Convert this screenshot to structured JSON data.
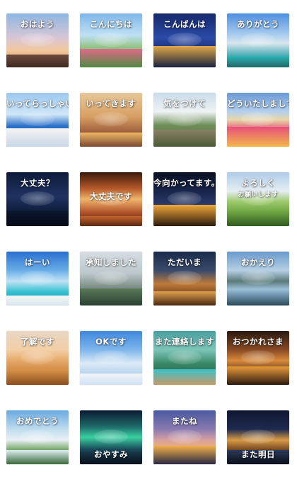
{
  "stickers": [
    {
      "id": "ohayou",
      "text": "おはよう",
      "pos": "top",
      "bg": "linear-gradient(180deg,#8fb6e2 0%,#d8c6d6 45%,#f3c79a 70%,#a86b4a 100%)",
      "ground": "linear-gradient(180deg,#6e4a3a,#3f2a22)",
      "gh": 18
    },
    {
      "id": "konnichiwa",
      "text": "こんにちは",
      "pos": "top",
      "bg": "linear-gradient(180deg,#7fb7e8 0%,#bfe0f5 40%,#8fc27a 65%,#3f7a3a 100%)",
      "ground": "linear-gradient(180deg,#e06a8a,#4f8a3f)",
      "gh": 26
    },
    {
      "id": "konbanwa",
      "text": "こんばんは",
      "pos": "top",
      "bg": "linear-gradient(180deg,#15286b 0%,#2b4aa8 45%,#1b2d6e 70%,#0d1634 100%)",
      "ground": "linear-gradient(180deg,#e0a84a,#1a2240)",
      "gh": 30
    },
    {
      "id": "arigatou",
      "text": "ありがとう",
      "pos": "top",
      "bg": "linear-gradient(180deg,#4f8fe0 0%,#a9cdef 40%,#d9e6ee 55%,#3fa7b0 80%,#2a6e6a 100%)",
      "ground": "linear-gradient(180deg,#2fb3b8,#1f6a66)",
      "gh": 16
    },
    {
      "id": "itterasshai",
      "text": "いってらっしゃい",
      "pos": "top",
      "bg": "linear-gradient(180deg,#9cc8f0 0%,#cfe6f7 40%,#2a6fc9 62%,#1d4fa0 100%)",
      "ground": "linear-gradient(180deg,#f4f4f4,#c9d6e6)",
      "gh": 26
    },
    {
      "id": "ittekimasu",
      "text": "いってきます",
      "pos": "top",
      "bg": "linear-gradient(180deg,#e7c89a 0%,#d79e62 45%,#9a5a3a 75%,#5a3524 100%)",
      "ground": "linear-gradient(180deg,#f0b765,#7a4a30)",
      "gh": 20
    },
    {
      "id": "kiotsukete",
      "text": "気をつけて",
      "pos": "top",
      "bg": "linear-gradient(180deg,#c9dbe9 0%,#eef2f4 35%,#6f8f5a 60%,#4c6a3a 100%)",
      "ground": "linear-gradient(180deg,#8a8066,#4a5a34)",
      "gh": 24
    },
    {
      "id": "douitashimashite",
      "text": "どういたしまして",
      "pos": "top",
      "bg": "linear-gradient(180deg,#6a9ad8 0%,#b5d0ee 35%,#e8d6a8 50%,#e25a7a 68%,#f0c24a 84%,#d23a5a 100%)",
      "ground": "linear-gradient(180deg,#e8507a,#f2b84a)",
      "gh": 28
    },
    {
      "id": "daijoubu-q",
      "text": "大丈夫？",
      "pos": "top",
      "bg": "linear-gradient(180deg,#0e1a3a 0%,#1f3262 45%,#10203f 70%,#071022 100%)",
      "ground": "linear-gradient(180deg,#0c1830,#050a16)",
      "gh": 22
    },
    {
      "id": "daijoubudesu",
      "text": "大丈夫です",
      "pos": "mid",
      "bg": "linear-gradient(180deg,#3a1a0c 0%,#b5582a 30%,#f0b46a 50%,#b0522a 75%,#3a180a 100%)",
      "ground": "linear-gradient(180deg,#c4622c,#5a2a12)",
      "gh": 14
    },
    {
      "id": "imamukattemasu",
      "text": "今向かってます。",
      "pos": "top",
      "bg": "linear-gradient(180deg,#0a1124 0%,#1b2850 40%,#2a3a6a 60%,#0d1530 100%)",
      "ground": "linear-gradient(180deg,#f2a83a,#2a1a10)",
      "gh": 30
    },
    {
      "id": "yoroshiku",
      "text": "よろしく",
      "sub": "お願いします",
      "pos": "top",
      "bg": "linear-gradient(180deg,#aecbe8 0%,#e6eef2 35%,#9cc86a 55%,#5e9a3a 80%,#3a6a24 100%)",
      "ground": "linear-gradient(180deg,#7ab44a,#2f5a20)",
      "gh": 24
    },
    {
      "id": "haai",
      "text": "はーい",
      "pos": "top",
      "bg": "linear-gradient(180deg,#2a6fd0 0%,#6aaee8 35%,#bfe2f4 55%,#34c0d0 75%,#1a8fa8 100%)",
      "ground": "linear-gradient(180deg,#f4f6f8,#d6e6ee)",
      "gh": 14
    },
    {
      "id": "shouchishimashita",
      "text": "承知しました",
      "pos": "top",
      "bg": "linear-gradient(180deg,#d6dde2 0%,#bcc8cc 40%,#7f918a 65%,#3f5a4a 100%)",
      "ground": "linear-gradient(180deg,#5a7a5a,#2a3f30)",
      "gh": 24
    },
    {
      "id": "tadaima",
      "text": "ただいま",
      "pos": "top",
      "bg": "linear-gradient(180deg,#1a2a4a 0%,#3a4a6a 35%,#c07a3a 60%,#6a3a1a 85%,#2a1408 100%)",
      "ground": "linear-gradient(180deg,#e0a050,#4a2810)",
      "gh": 20
    },
    {
      "id": "okaeri",
      "text": "おかえり",
      "pos": "top",
      "bg": "linear-gradient(180deg,#6a9acc 0%,#b6cfe4 35%,#5a7a7a 55%,#9cc0d8 70%,#2a4a5a 100%)",
      "ground": "linear-gradient(180deg,#8ab0cc,#2a4a5a)",
      "gh": 20
    },
    {
      "id": "ryoukaidesu",
      "text": "了解です",
      "pos": "top",
      "bg": "linear-gradient(180deg,#e8d6c4 0%,#f2cfa6 35%,#e6a868 55%,#c9803a 80%,#9a5a24 100%)",
      "ground": "linear-gradient(180deg,#d9944a,#8a4e1e)",
      "gh": 22
    },
    {
      "id": "okdesu",
      "text": "OKです",
      "pos": "top",
      "bg": "linear-gradient(180deg,#3f88dc 0%,#7fb6ec 35%,#dceaf6 60%,#b8d4ee 80%,#8ab8e4 100%)",
      "ground": "linear-gradient(180deg,#f2f6fa,#cfe0f2)",
      "gh": 16
    },
    {
      "id": "matarenraku",
      "text": "また連絡します",
      "pos": "top",
      "bg": "linear-gradient(180deg,#4aa0a0 0%,#7cc4b8 35%,#3a8a6a 60%,#2a6a4a 80%,#1a4a34 100%)",
      "ground": "linear-gradient(180deg,#3ec0c8,#c49a6a)",
      "gh": 22
    },
    {
      "id": "otsukaresama",
      "text": "おつかれさま",
      "pos": "top",
      "bg": "linear-gradient(180deg,#2a1a12 0%,#8a4a24 35%,#d88a3a 55%,#4a2a18 80%,#1a0e08 100%)",
      "ground": "linear-gradient(180deg,#e89a3a,#2a1a10)",
      "gh": 26
    },
    {
      "id": "omedetou",
      "text": "おめでとう",
      "pos": "top",
      "bg": "linear-gradient(180deg,#6aaae0 0%,#bfdcef 35%,#e8f0f4 55%,#6aa05a 75%,#2a5a2a 100%)",
      "ground": "linear-gradient(180deg,#dfeef4,#3a6a3a)",
      "gh": 20
    },
    {
      "id": "oyasumi",
      "text": "おやすみ",
      "pos": "bottom",
      "bg": "linear-gradient(180deg,#0a1a34 0%,#1e6a6a 30%,#3ad0a0 50%,#1a4a5a 72%,#0a1424 100%)",
      "ground": "linear-gradient(180deg,#1a3a4a,#06101c)",
      "gh": 18
    },
    {
      "id": "matane",
      "text": "またね",
      "pos": "top",
      "bg": "linear-gradient(180deg,#4a5aa0 0%,#8a7ab0 35%,#d8a0a0 55%,#f0b46a 72%,#3a3a5a 100%)",
      "ground": "linear-gradient(180deg,#f2b04a,#2a2a44)",
      "gh": 26
    },
    {
      "id": "matashita",
      "text": "また明日",
      "pos": "bottom",
      "bg": "linear-gradient(180deg,#0e1630 0%,#1e2a50 35%,#d89a44 55%,#6a4020 75%,#10121e 100%)",
      "ground": "linear-gradient(180deg,#2a3a5a,#0a0e1a)",
      "gh": 20
    }
  ]
}
